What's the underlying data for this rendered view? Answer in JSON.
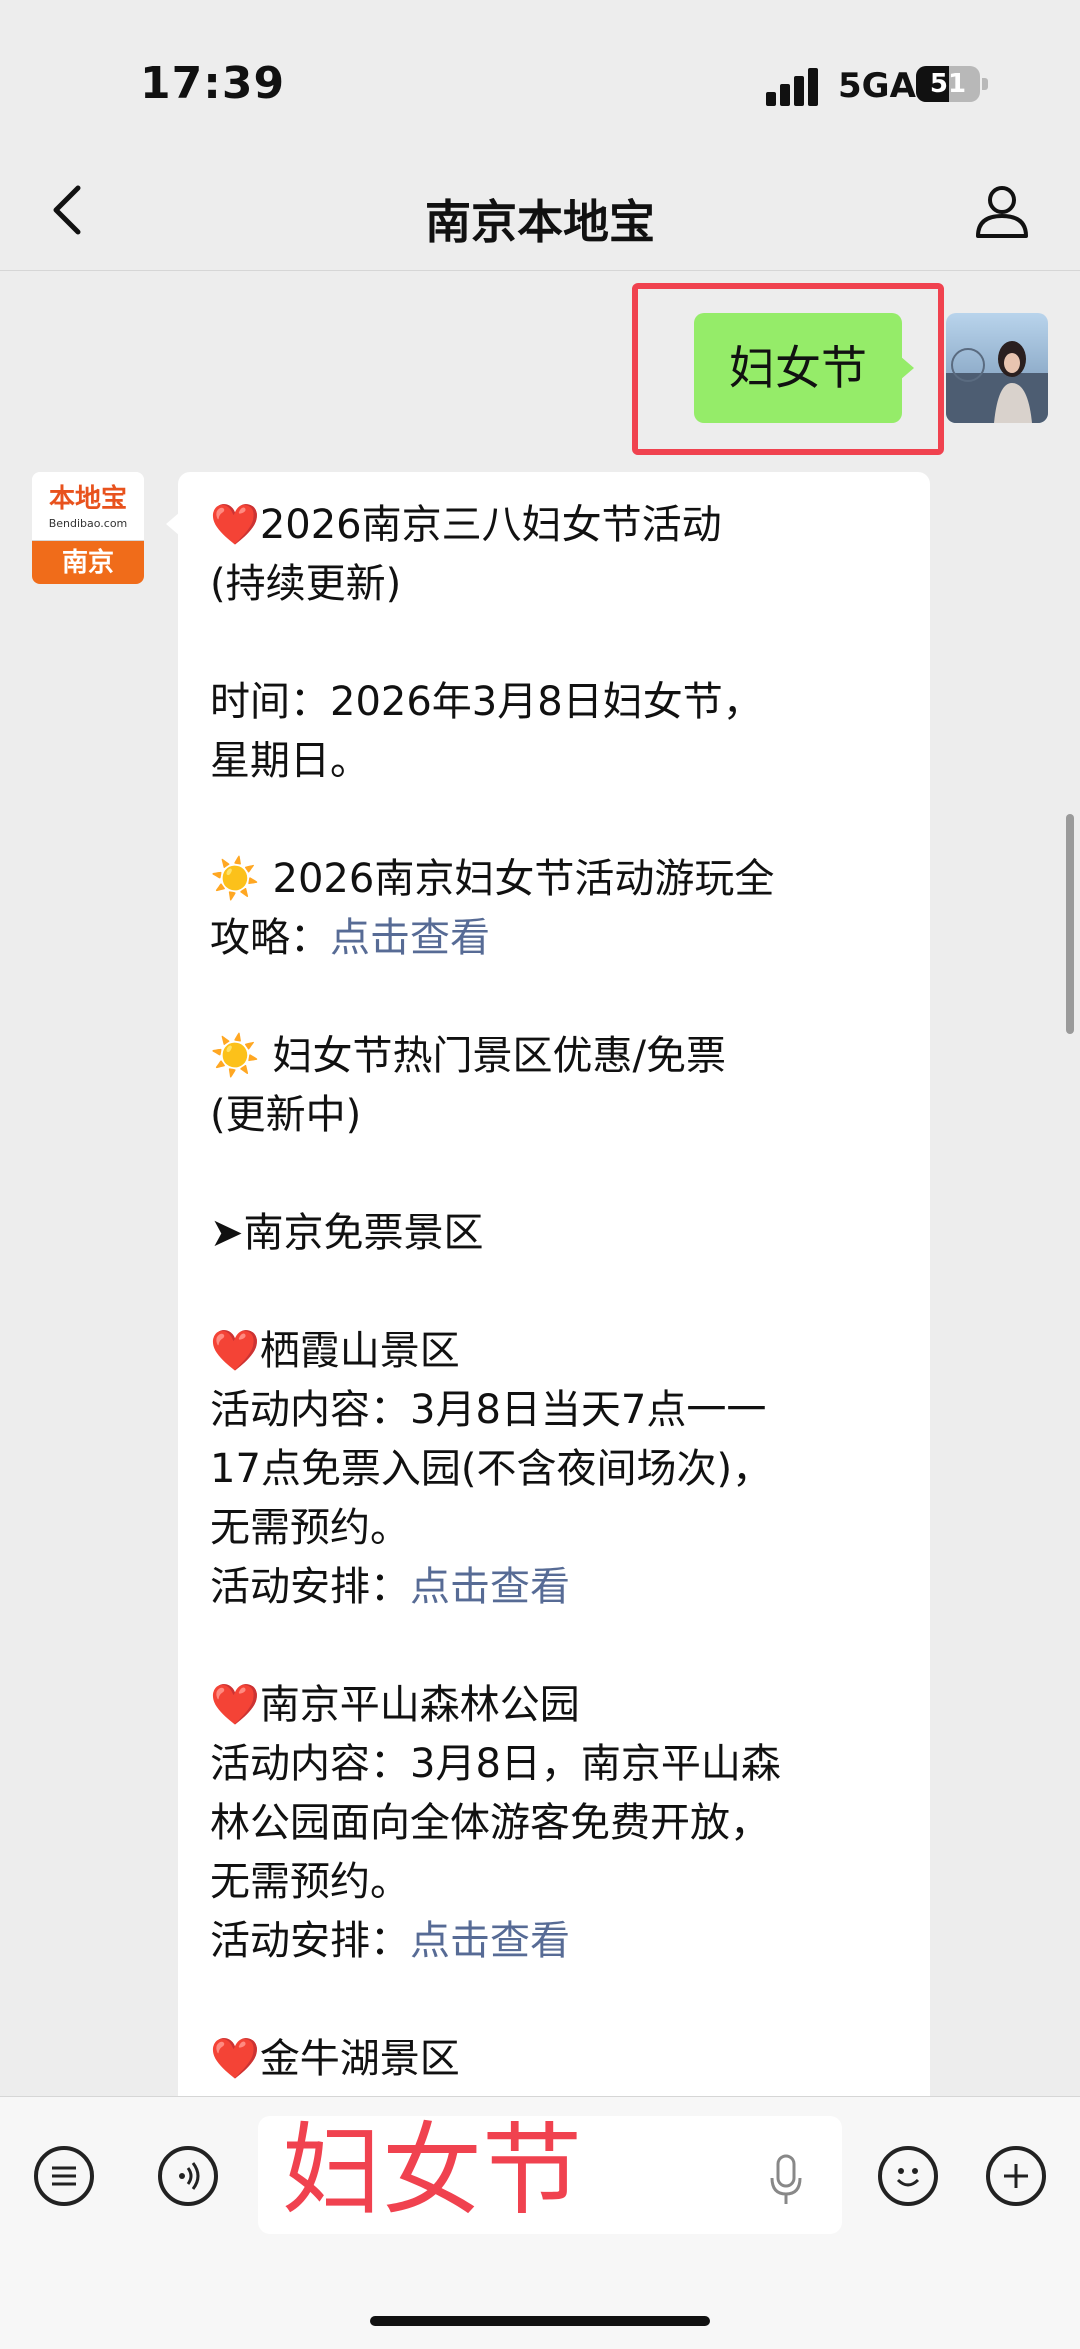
{
  "status": {
    "time": "17:39",
    "network": "5GA",
    "battery": "51"
  },
  "nav": {
    "title": "南京本地宝"
  },
  "sent": {
    "text": "妇女节"
  },
  "brand": {
    "name": "本地宝",
    "sub": "Bendibao.com",
    "city": "南京"
  },
  "message": {
    "lines": [
      {
        "pre": "❤️",
        "text": "2026南京三八妇女节活动\n(持续更新)"
      },
      {
        "text": "时间：2026年3月8日妇女节，\n星期日。"
      },
      {
        "pre": "☀️",
        "text": " 2026南京妇女节活动游玩全\n攻略：",
        "link": "点击查看"
      },
      {
        "pre": "☀️",
        "text": " 妇女节热门景区优惠/免票\n(更新中)"
      },
      {
        "text": "➤南京免票景区"
      },
      {
        "pre": "❤️",
        "text": "栖霞山景区\n活动内容：3月8日当天7点一一\n17点免票入园(不含夜间场次)，\n无需预约。\n活动安排：",
        "link": "点击查看"
      },
      {
        "pre": "❤️",
        "text": "南京平山森林公园\n活动内容：3月8日，南京平山森\n林公园面向全体游客免费开放，\n无需预约。\n活动安排：",
        "link": "点击查看"
      },
      {
        "pre": "❤️",
        "text": "金牛湖景区"
      }
    ]
  },
  "input": {
    "text": "妇女节"
  },
  "icons": [
    "back-icon",
    "person-icon",
    "list-icon",
    "voice-icon",
    "mic-icon",
    "emoji-icon",
    "plus-icon"
  ]
}
